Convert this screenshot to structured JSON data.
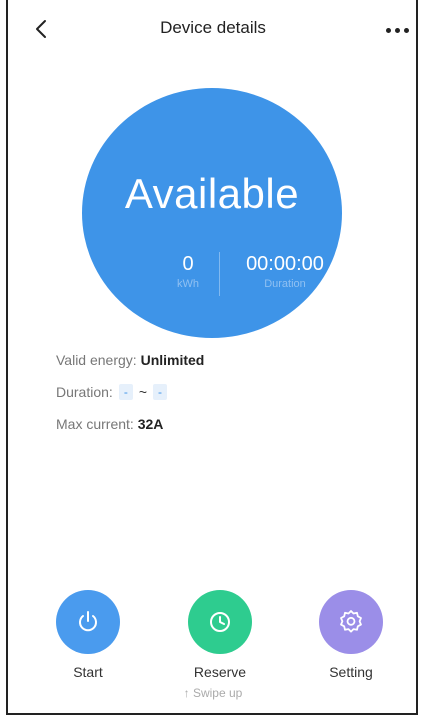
{
  "header": {
    "title": "Device details",
    "back_icon": "chevron-left-icon",
    "more_icon": "more-horizontal-icon"
  },
  "status_circle": {
    "status": "Available",
    "energy_value": "0",
    "energy_unit": "kWh",
    "duration_value": "00:00:00",
    "duration_label": "Duration",
    "color": "#3E94E8"
  },
  "info": {
    "valid_energy_label": "Valid energy:",
    "valid_energy_value": "Unlimited",
    "duration_label": "Duration:",
    "duration_start": "-",
    "duration_separator": "~",
    "duration_end": "-",
    "max_current_label": "Max current:",
    "max_current_value": "32A"
  },
  "actions": {
    "start": {
      "label": "Start",
      "icon": "power-icon",
      "color": "#4A9BEE"
    },
    "reserve": {
      "label": "Reserve",
      "icon": "clock-icon",
      "color": "#2ECC8F"
    },
    "setting": {
      "label": "Setting",
      "icon": "gear-icon",
      "color": "#9B8EE8"
    }
  },
  "footer": {
    "swipe_hint": "↑ Swipe up"
  }
}
